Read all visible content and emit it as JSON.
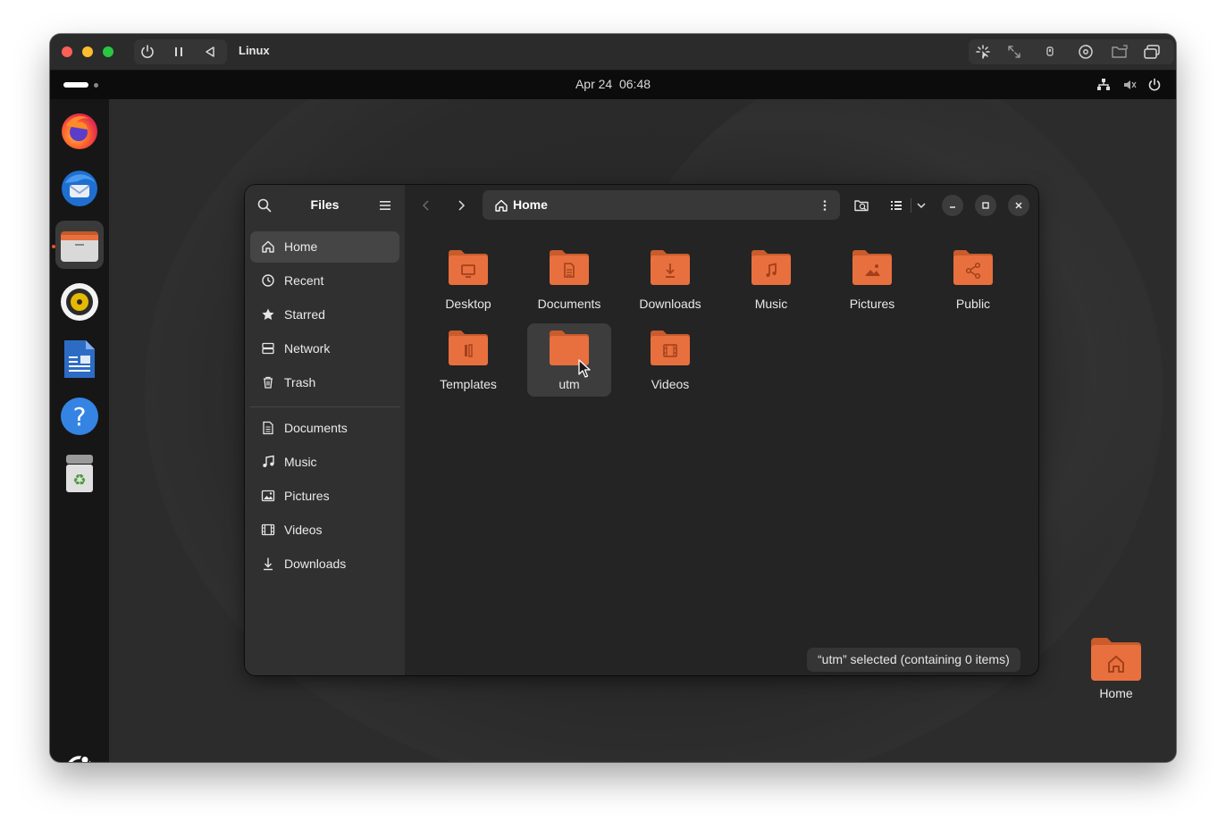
{
  "vm_window": {
    "title": "Linux"
  },
  "topbar": {
    "date": "Apr 24",
    "time": "06:48"
  },
  "dock": {
    "apps": [
      {
        "name": "firefox-icon"
      },
      {
        "name": "thunderbird-icon"
      },
      {
        "name": "files-icon",
        "active": true
      },
      {
        "name": "rhythmbox-icon"
      },
      {
        "name": "libreoffice-writer-icon"
      },
      {
        "name": "help-icon"
      },
      {
        "name": "trash-icon"
      }
    ],
    "show_apps": "ubuntu-logo-icon"
  },
  "files": {
    "sidebar": {
      "title": "Files",
      "places": [
        {
          "label": "Home",
          "icon": "home-icon",
          "selected": true
        },
        {
          "label": "Recent",
          "icon": "clock-icon"
        },
        {
          "label": "Starred",
          "icon": "star-icon"
        },
        {
          "label": "Network",
          "icon": "network-icon"
        },
        {
          "label": "Trash",
          "icon": "trash-icon"
        }
      ],
      "bookmarks": [
        {
          "label": "Documents",
          "icon": "document-icon"
        },
        {
          "label": "Music",
          "icon": "music-icon"
        },
        {
          "label": "Pictures",
          "icon": "picture-icon"
        },
        {
          "label": "Videos",
          "icon": "video-icon"
        },
        {
          "label": "Downloads",
          "icon": "download-icon"
        }
      ]
    },
    "path": {
      "label": "Home"
    },
    "items": [
      {
        "label": "Desktop",
        "emblem": "desktop"
      },
      {
        "label": "Documents",
        "emblem": "document"
      },
      {
        "label": "Downloads",
        "emblem": "download"
      },
      {
        "label": "Music",
        "emblem": "music"
      },
      {
        "label": "Pictures",
        "emblem": "picture"
      },
      {
        "label": "Public",
        "emblem": "share"
      },
      {
        "label": "Templates",
        "emblem": "template"
      },
      {
        "label": "utm",
        "emblem": "none",
        "selected": true
      },
      {
        "label": "Videos",
        "emblem": "video"
      }
    ],
    "status": "“utm” selected  (containing 0 items)"
  },
  "desktop": {
    "home_icon_label": "Home"
  },
  "colors": {
    "accent": "#e95420",
    "folder": "#e8703e",
    "folder_tab": "#c95b2c"
  }
}
